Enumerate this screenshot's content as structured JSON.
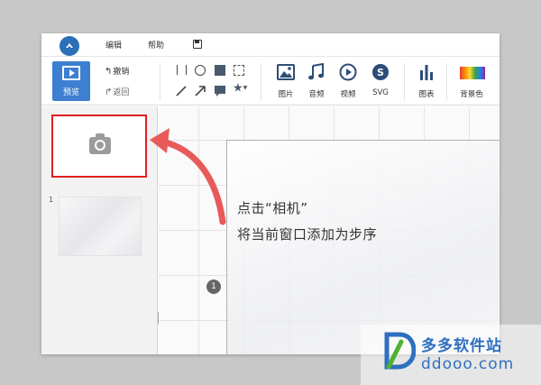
{
  "menu": {
    "items": [
      {
        "label": "编辑"
      },
      {
        "label": "帮助"
      }
    ]
  },
  "toolbar": {
    "preview_label": "预览",
    "undo_label": "撤销",
    "redo_label": "返回",
    "media": [
      {
        "label": "图片",
        "icon": "image-icon"
      },
      {
        "label": "音频",
        "icon": "music-icon"
      },
      {
        "label": "视频",
        "icon": "video-icon"
      },
      {
        "label": "SVG",
        "icon": "svg-icon"
      },
      {
        "label": "图表",
        "icon": "chart-icon"
      },
      {
        "label": "背景色",
        "icon": "palette-icon"
      }
    ]
  },
  "sidebar": {
    "slide_number": "1"
  },
  "canvas": {
    "step_badge": "1"
  },
  "annotation": {
    "line1": "点击“相机”",
    "line2": "将当前窗口添加为步序"
  },
  "watermark": {
    "cn": "多多软件站",
    "en": "ddooo.com"
  },
  "colors": {
    "accent": "#3d7fd0",
    "highlight_border": "#e0201f",
    "arrow": "#e85a5a"
  }
}
